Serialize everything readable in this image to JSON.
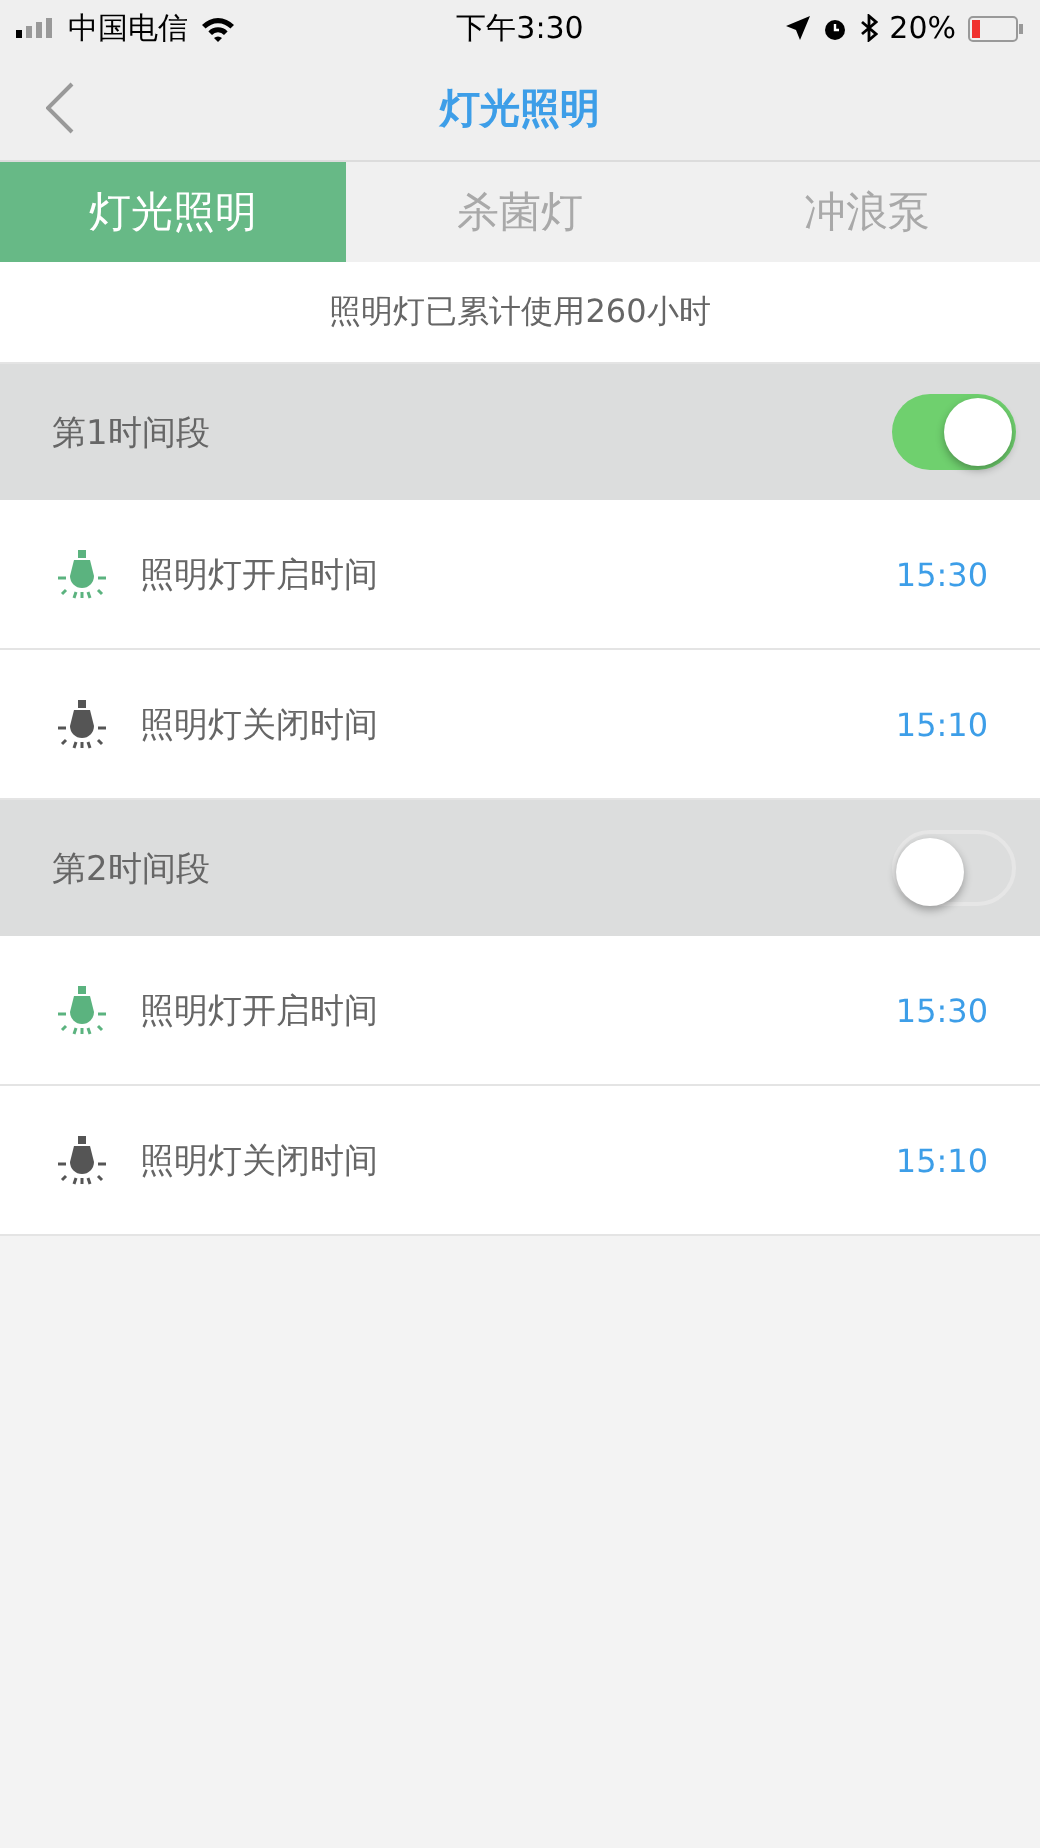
{
  "status_bar": {
    "carrier": "中国电信",
    "time": "下午3:30",
    "battery": "20%"
  },
  "nav": {
    "title": "灯光照明"
  },
  "tabs": [
    {
      "label": "灯光照明",
      "selected": true
    },
    {
      "label": "杀菌灯",
      "selected": false
    },
    {
      "label": "冲浪泵",
      "selected": false
    }
  ],
  "usage": "照明灯已累计使用260小时",
  "periods": [
    {
      "label": "第1时间段",
      "on": true,
      "rows": [
        {
          "kind": "on",
          "label": "照明灯开启时间",
          "time": "15:30"
        },
        {
          "kind": "off",
          "label": "照明灯关闭时间",
          "time": "15:10"
        }
      ]
    },
    {
      "label": "第2时间段",
      "on": false,
      "rows": [
        {
          "kind": "on",
          "label": "照明灯开启时间",
          "time": "15:30"
        },
        {
          "kind": "off",
          "label": "照明灯关闭时间",
          "time": "15:10"
        }
      ]
    }
  ]
}
